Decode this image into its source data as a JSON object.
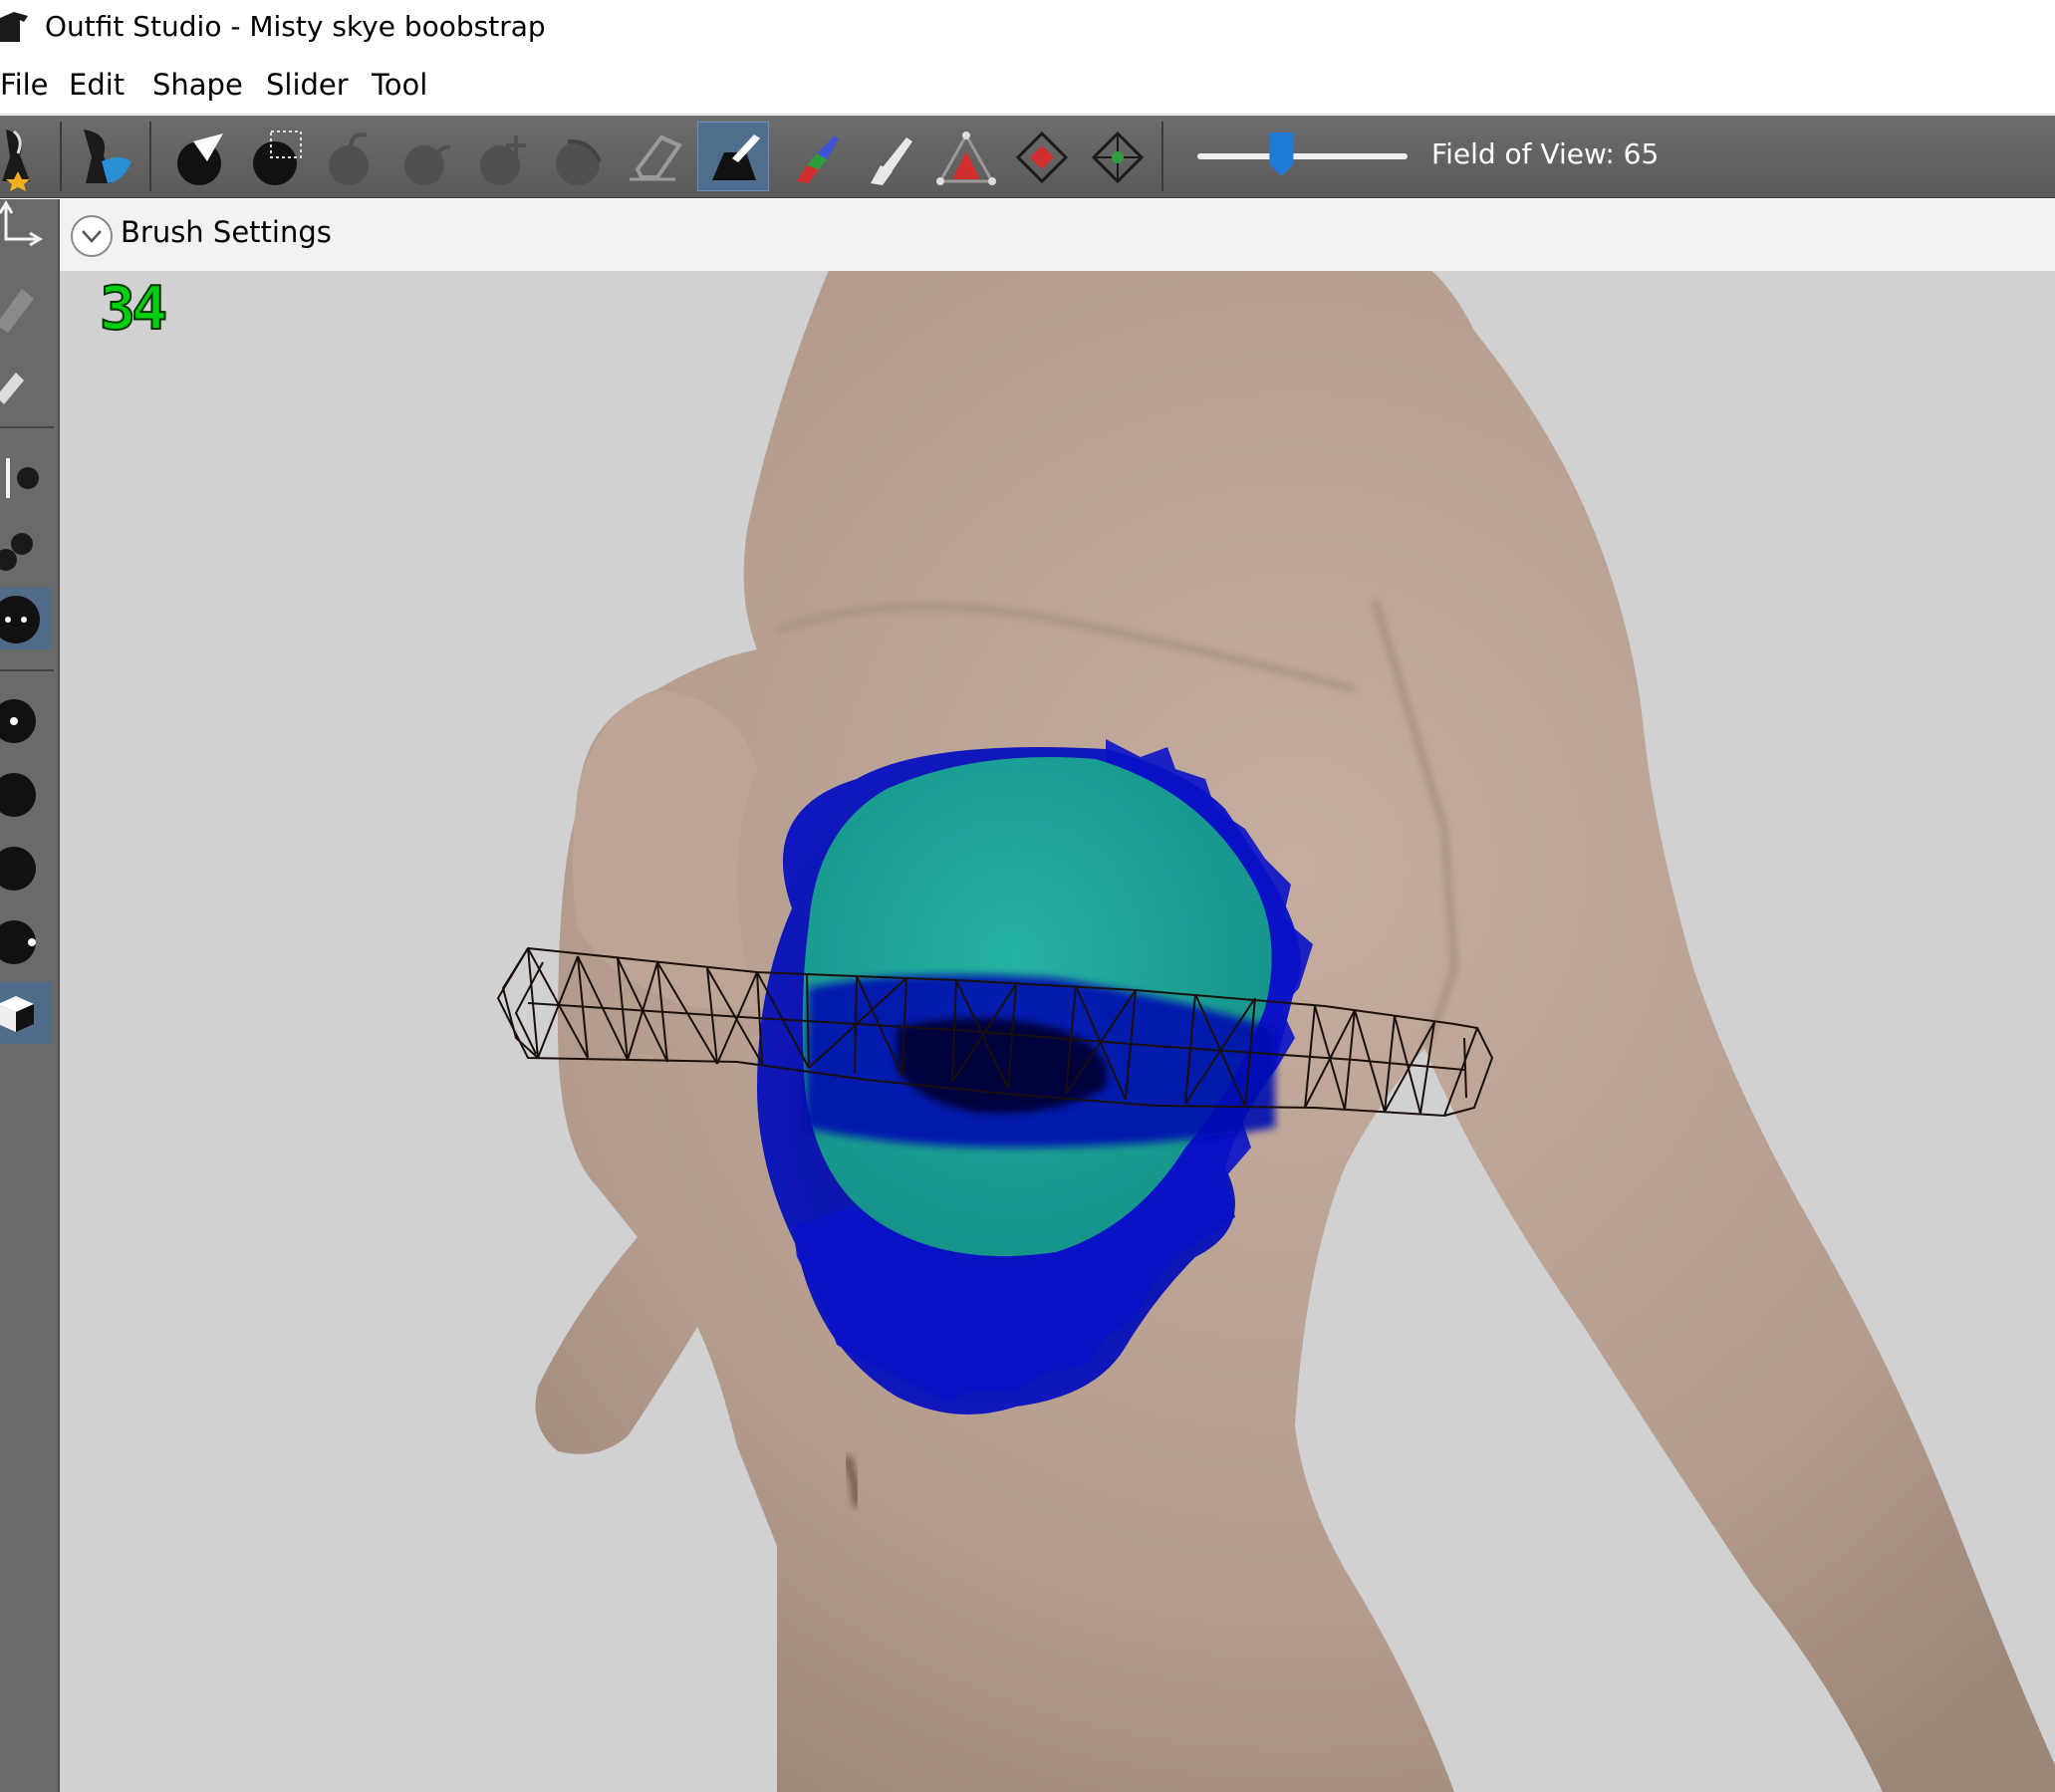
{
  "window": {
    "title": "Outfit Studio - Misty skye boobstrap"
  },
  "menubar": {
    "items": [
      "File",
      "Edit",
      "Shape",
      "Slider",
      "Tool"
    ]
  },
  "toolbar": {
    "icons": [
      "reference-shape-icon",
      "outfit-shape-icon",
      "select-brush-icon",
      "mask-select-icon",
      "inflate-brush-icon",
      "deflate-brush-icon",
      "move-brush-icon",
      "smooth-brush-icon",
      "erase-brush-icon",
      "mask-brush-icon",
      "color-brush-icon",
      "alpha-brush-icon",
      "weight-brush-icon",
      "collapse-vertex-icon",
      "flip-edge-icon"
    ],
    "active_icon": "mask-brush-icon",
    "field_of_view_label": "Field of View: 65",
    "field_of_view_value": 65,
    "field_of_view_fraction": 0.4
  },
  "left_toolbar": {
    "icons": [
      "transform-icon",
      "pivot-icon",
      "vertex-select-icon",
      "x-mirror-icon",
      "connected-only-icon",
      "show-points-icon",
      "wireframe-icon",
      "lighting-icon",
      "textures-icon",
      "color-icon",
      "bones-icon",
      "cube-icon"
    ],
    "active_icons": [
      "show-points-icon",
      "cube-icon"
    ]
  },
  "brush_settings": {
    "label": "Brush Settings",
    "collapsed": true
  },
  "viewport": {
    "fps": "34",
    "fps_color": "#00d010",
    "background": "#d1d1d1",
    "mask_color": "#0a12c8",
    "highlight_color": "#1aa69a"
  },
  "colors": {
    "toolbar_bg": "#636363",
    "active_button": "#4f6d8c",
    "skin": "#b8a293"
  }
}
